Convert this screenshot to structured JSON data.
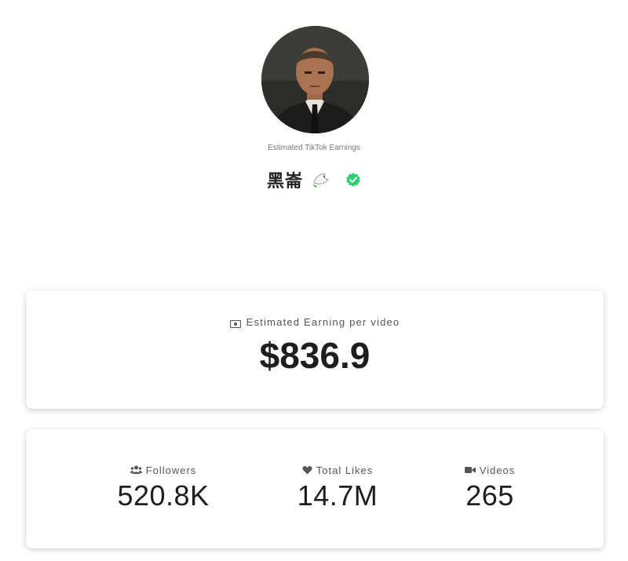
{
  "profile": {
    "subtitle": "Estimated TikTok Earnings",
    "username": "黑崙"
  },
  "icons": {
    "avatar": "avatar-portrait",
    "dove": "dove-icon",
    "verified": "verified-badge-icon",
    "money": "money-bill-icon",
    "followers": "users-icon",
    "likes": "heart-icon",
    "videos": "video-camera-icon"
  },
  "colors": {
    "verified": "#2ecc71",
    "text": "#1e1e1e",
    "muted": "#555555"
  },
  "earnings": {
    "label": "Estimated Earning per video",
    "value": "$836.9"
  },
  "stats": [
    {
      "label": "Followers",
      "value": "520.8K"
    },
    {
      "label": "Total Likes",
      "value": "14.7M"
    },
    {
      "label": "Videos",
      "value": "265"
    }
  ]
}
